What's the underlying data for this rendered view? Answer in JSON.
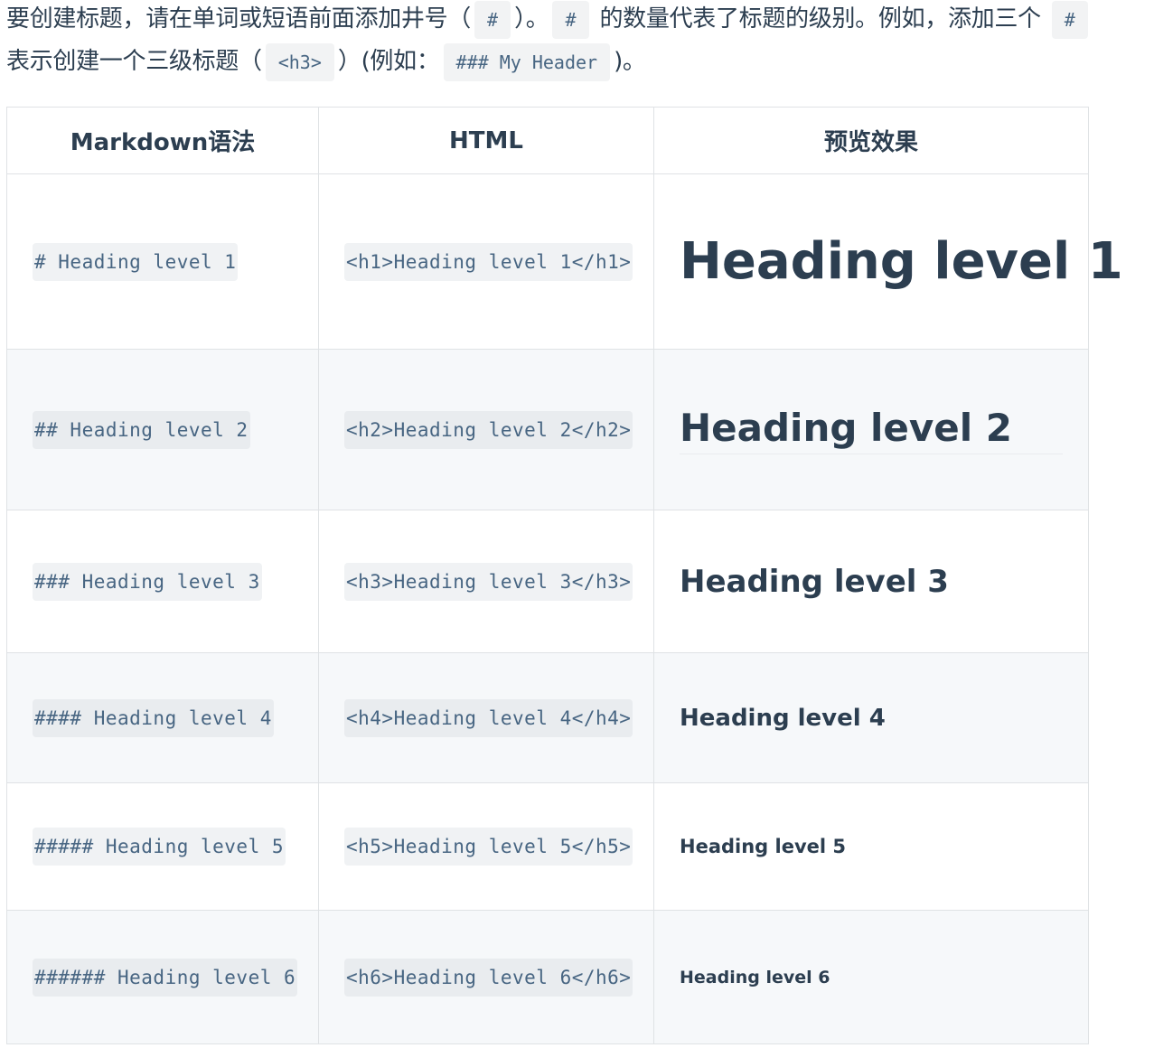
{
  "intro": {
    "line1_a": "要创建标题，请在单词或短语前面添加井号（",
    "code_hash_1": "#",
    "line1_b": "）。",
    "code_hash_2": "#",
    "line1_c": " 的数量代表了标题的级别。例如，添加三个 ",
    "code_hash_3": "#",
    "line2_a": "表示创建一个三级标题（",
    "code_h3": "<h3>",
    "line2_b": "）(例如：",
    "code_example": "### My Header",
    "line2_c": ")。"
  },
  "table": {
    "headers": [
      "Markdown语法",
      "HTML",
      "预览效果"
    ],
    "rows": [
      {
        "markdown": "# Heading level 1",
        "html": "<h1>Heading level 1</h1>",
        "preview": "Heading level 1"
      },
      {
        "markdown": "## Heading level 2",
        "html": "<h2>Heading level 2</h2>",
        "preview": "Heading level 2"
      },
      {
        "markdown": "### Heading level 3",
        "html": "<h3>Heading level 3</h3>",
        "preview": "Heading level 3"
      },
      {
        "markdown": "#### Heading level 4",
        "html": "<h4>Heading level 4</h4>",
        "preview": "Heading level 4"
      },
      {
        "markdown": "##### Heading level 5",
        "html": "<h5>Heading level 5</h5>",
        "preview": "Heading level 5"
      },
      {
        "markdown": "###### Heading level 6",
        "html": "<h6>Heading level 6</h6>",
        "preview": "Heading level 6"
      }
    ]
  },
  "colors": {
    "text": "#2c3e50",
    "code_text": "#476582",
    "code_bg": "#f0f2f4",
    "border": "#dfe2e5",
    "stripe_bg": "#f6f8fa"
  }
}
